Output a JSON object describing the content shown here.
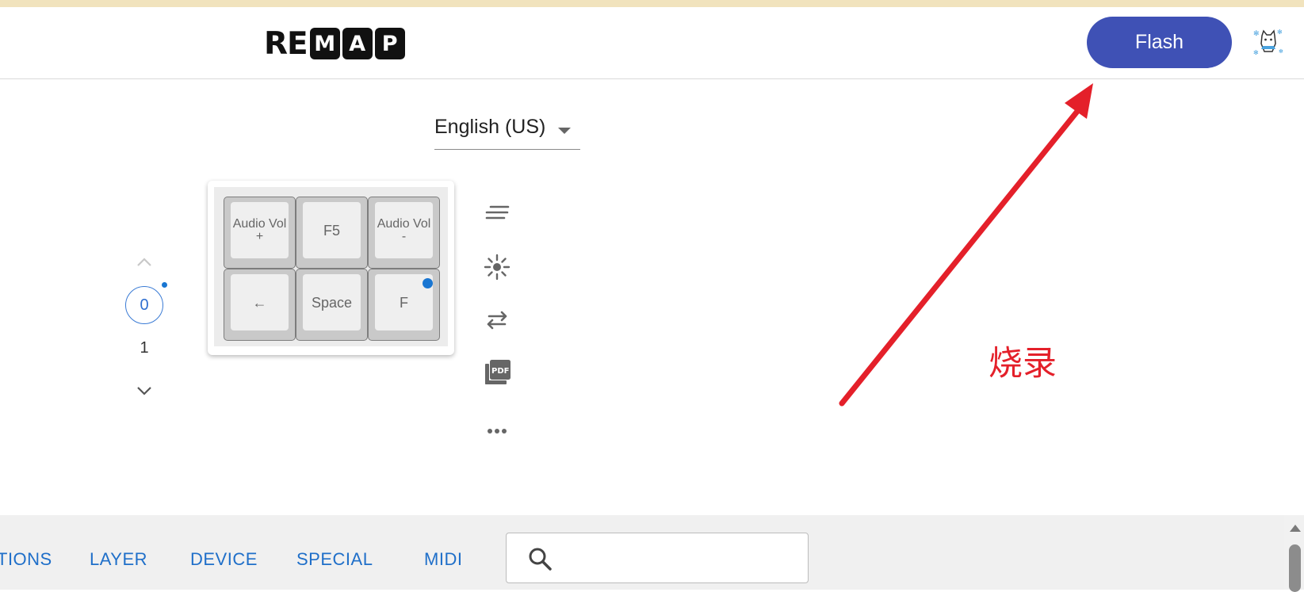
{
  "header": {
    "logo": {
      "letters_plain": "RE",
      "boxed": [
        "M",
        "A",
        "P"
      ]
    },
    "flash_label": "Flash",
    "accent_color": "#3f51b5"
  },
  "language_select": {
    "selected": "English (US)"
  },
  "layers": {
    "items": [
      "0",
      "1"
    ],
    "selected": "0"
  },
  "keyboard": {
    "keys": [
      {
        "label": "Audio Vol +"
      },
      {
        "label": "F5"
      },
      {
        "label": "Audio Vol -"
      },
      {
        "label": "←"
      },
      {
        "label": "Space"
      },
      {
        "label": "F",
        "has_dot": true
      }
    ]
  },
  "tools": [
    "menu-lines-icon",
    "lighting-icon",
    "swap-arrows-icon",
    "pdf-icon",
    "more-horizontal-icon"
  ],
  "annotation": {
    "text": "烧录",
    "color": "#e4202a"
  },
  "bottom_tabs": [
    "TIONS",
    "LAYER",
    "DEVICE",
    "SPECIAL",
    "MIDI"
  ],
  "search": {
    "placeholder": "",
    "value": ""
  }
}
